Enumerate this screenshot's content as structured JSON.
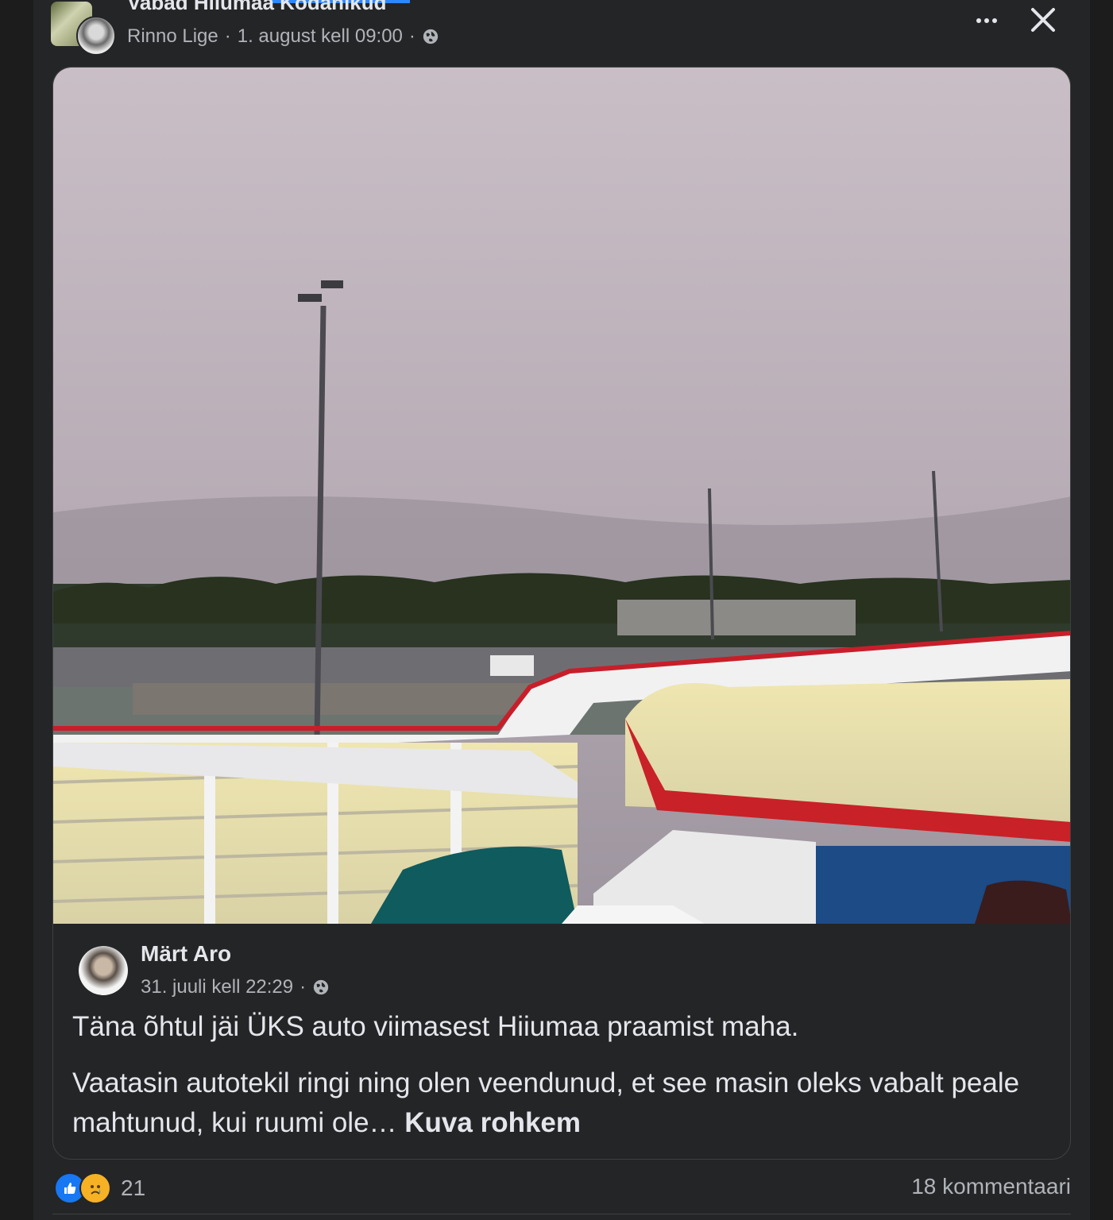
{
  "post": {
    "group_name": "Vabad Hiiumaa Kodanikud",
    "author": "Rinno Lige",
    "separator": "·",
    "timestamp": "1. august kell 09:00",
    "privacy_icon": "globe-icon",
    "more_icon": "more-options-icon",
    "close_icon": "close-icon"
  },
  "shared": {
    "author": "Märt Aro",
    "timestamp": "31. juuli kell 22:29",
    "privacy_icon": "globe-icon",
    "text_line_1": "Täna õhtul jäi ÜKS auto viimasest Hiiumaa praamist maha.",
    "text_line_2": "Vaatasin autotekil ringi ning olen veendunud, et see masin oleks vabalt peale mahtunud, kui ruumi ole…",
    "see_more": "Kuva rohkem"
  },
  "footer": {
    "reaction_icons": [
      "like-icon",
      "sad-icon"
    ],
    "reaction_count": "21",
    "comments": "18 kommentaari"
  },
  "colors": {
    "background": "#242526",
    "text": "#e4e6eb",
    "secondary_text": "#b0b3b8",
    "accent": "#2d88ff",
    "like": "#1877f2",
    "sad": "#f7b125"
  }
}
